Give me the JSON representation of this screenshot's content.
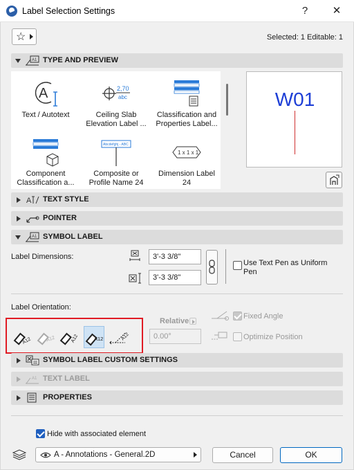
{
  "window": {
    "title": "Label Selection Settings",
    "help_glyph": "?",
    "close_glyph": "✕"
  },
  "header": {
    "selected_info": "Selected: 1 Editable: 1"
  },
  "sections": {
    "type_and_preview": "TYPE AND PREVIEW",
    "text_style": "TEXT STYLE",
    "pointer": "POINTER",
    "symbol_label": "SYMBOL LABEL",
    "symbol_label_custom": "SYMBOL LABEL CUSTOM SETTINGS",
    "text_label": "TEXT LABEL",
    "properties": "PROPERTIES"
  },
  "label_types": [
    {
      "line1": "Text / Autotext",
      "line2": "",
      "icon": "text-autotext-icon"
    },
    {
      "line1": "Ceiling Slab",
      "line2": "Elevation Label ...",
      "icon": "ceiling-slab-icon"
    },
    {
      "line1": "Classification and",
      "line2": "Properties Label...",
      "icon": "classification-icon"
    },
    {
      "line1": "Component",
      "line2": "Classification a...",
      "icon": "component-icon"
    },
    {
      "line1": "Composite or",
      "line2": "Profile Name 24",
      "icon": "composite-icon"
    },
    {
      "line1": "Dimension Label",
      "line2": "24",
      "icon": "dimension-label-icon"
    }
  ],
  "tile_glyphs": {
    "ceiling_value": "2,70",
    "ceiling_unit": "abc",
    "composite_text": "Abcdefghj - ABC",
    "dimension_text": "1 x 1 x 1"
  },
  "preview": {
    "text": "W01",
    "text_color": "#1e3fd6",
    "line_color": "#d03030"
  },
  "symbol_label": {
    "label_dimensions": "Label Dimensions:",
    "width_value": "3'-3 3/8\"",
    "height_value": "3'-3 3/8\"",
    "use_text_pen_line1": "Use Text Pen as Uniform",
    "use_text_pen_line2": "Pen",
    "use_text_pen_checked": false,
    "label_orientation": "Label Orientation:",
    "orientation_selected_index": 3,
    "relative_label": "Relative",
    "angle_value": "0.00°",
    "fixed_angle": "Fixed Angle",
    "fixed_angle_checked": true,
    "optimize_position": "Optimize Position",
    "optimize_position_checked": false
  },
  "footer": {
    "hide_with_element": "Hide with associated element",
    "hide_with_element_checked": true,
    "layer": "A - Annotations - General.2D",
    "cancel": "Cancel",
    "ok": "OK"
  },
  "colors": {
    "accent": "#1f5fbf",
    "highlight_box": "#e01b24",
    "section_bg": "#dcdcdc"
  }
}
